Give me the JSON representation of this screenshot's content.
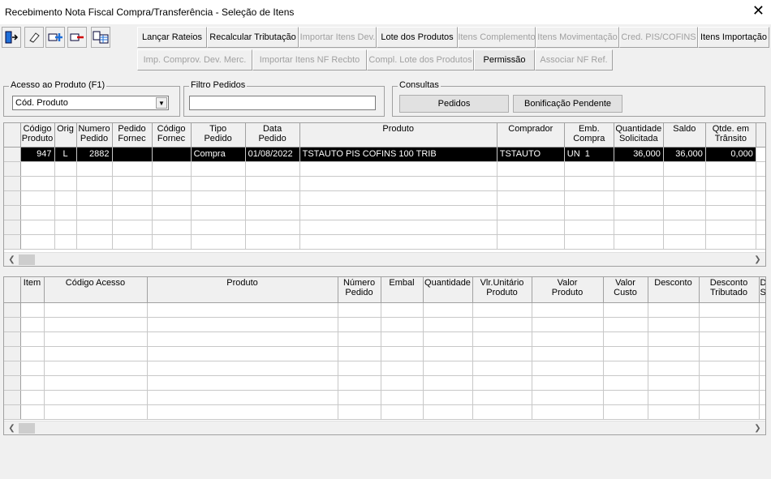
{
  "window": {
    "title": "Recebimento Nota Fiscal Compra/Transferência - Seleção de Itens",
    "close_glyph": "✕"
  },
  "toolbar_icons": [
    "exit-door-icon",
    "eraser-icon",
    "add-item-icon",
    "remove-item-icon",
    "grid-list-icon"
  ],
  "toolbar_row1": [
    {
      "label": "Lançar Rateios",
      "enabled": true
    },
    {
      "label": "Recalcular Tributação",
      "enabled": true
    },
    {
      "label": "Importar Itens Dev.",
      "enabled": false
    },
    {
      "label": "Lote dos Produtos",
      "enabled": true
    },
    {
      "label": "Itens Complemento",
      "enabled": false
    },
    {
      "label": "Itens Movimentação",
      "enabled": false
    },
    {
      "label": "Cred. PIS/COFINS",
      "enabled": false
    },
    {
      "label": "Itens Importação",
      "enabled": true
    }
  ],
  "toolbar_row2": [
    {
      "label": "Imp. Comprov. Dev. Merc.",
      "enabled": false
    },
    {
      "label": "Importar Itens NF Recbto",
      "enabled": false
    },
    {
      "label": "Compl. Lote dos Produtos",
      "enabled": false
    },
    {
      "label": "Permissão",
      "enabled": true
    },
    {
      "label": "Associar NF Ref.",
      "enabled": false
    }
  ],
  "acesso_produto": {
    "label": "Acesso ao Produto (F1)",
    "value": "Cód. Produto"
  },
  "filtro_pedidos": {
    "label": "Filtro Pedidos",
    "value": ""
  },
  "consultas": {
    "label": "Consultas",
    "pedidos_button": "Pedidos",
    "bonificacao_button": "Bonificação Pendente"
  },
  "grid_pedidos": {
    "headers": [
      [
        "Código",
        "Produto"
      ],
      [
        "Orig",
        ""
      ],
      [
        "Numero",
        "Pedido"
      ],
      [
        "Pedido",
        "Fornec"
      ],
      [
        "Código",
        "Fornec"
      ],
      [
        "Tipo",
        "Pedido"
      ],
      [
        "Data",
        "Pedido"
      ],
      [
        "Produto",
        ""
      ],
      [
        "Comprador",
        ""
      ],
      [
        "Emb.",
        "Compra"
      ],
      [
        "Quantidade",
        "Solicitada"
      ],
      [
        "Saldo",
        ""
      ],
      [
        "Qtde. em",
        "Trânsito"
      ]
    ],
    "rows": [
      [
        "947",
        "L",
        "2882",
        "",
        "",
        "Compra",
        "01/08/2022",
        "TSTAUTO PIS COFINS 100 TRIB",
        "TSTAUTO",
        "UN  1",
        "36,000",
        "36,000",
        "0,000"
      ]
    ],
    "empty_rows": 6
  },
  "grid_itens": {
    "headers": [
      [
        "Item",
        ""
      ],
      [
        "Código Acesso",
        ""
      ],
      [
        "Produto",
        ""
      ],
      [
        "Número",
        "Pedido"
      ],
      [
        "Embal",
        ""
      ],
      [
        "Quantidade",
        ""
      ],
      [
        "Vlr.Unitário",
        "Produto"
      ],
      [
        "Valor",
        "Produto"
      ],
      [
        "Valor",
        "Custo"
      ],
      [
        "Desconto",
        ""
      ],
      [
        "Desconto",
        "Tributado"
      ],
      [
        "D",
        "S"
      ]
    ],
    "empty_rows": 8
  }
}
